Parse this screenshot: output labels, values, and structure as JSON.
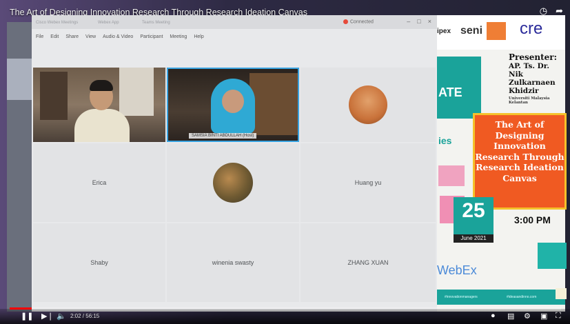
{
  "video": {
    "title": "The Art of Designing Innovation Research Through Research Ideation Canvas",
    "time": "2:02 / 56:15",
    "progress": 0.04
  },
  "webex": {
    "tabs": [
      "Cisco Webex Meetings",
      "Webex App",
      "Teams Meeting"
    ],
    "connection": "Connected",
    "menu": [
      "File",
      "Edit",
      "Share",
      "View",
      "Audio & Video",
      "Participant",
      "Meeting",
      "Help"
    ],
    "participants": [
      {
        "name": "",
        "type": "video"
      },
      {
        "name": "SAMSIA BINTI ABDULLAH (Host)",
        "type": "video"
      },
      {
        "name": "",
        "type": "avatar"
      },
      {
        "name": "Erica",
        "type": "name"
      },
      {
        "name": "",
        "type": "avatar"
      },
      {
        "name": "Huang yu",
        "type": "name"
      },
      {
        "name": "Shaby",
        "type": "name"
      },
      {
        "name": "winenia swasty",
        "type": "name"
      },
      {
        "name": "ZHANG XUAN",
        "type": "name"
      }
    ]
  },
  "slide": {
    "logo1": "ipex",
    "logo2": "seni",
    "logo3": "cre",
    "partial_word": "ATE",
    "partial_word2": "ies",
    "presenter_label": "Presenter:",
    "presenter_name": "AP. Ts. Dr. Nik Zulkarnaen Khidzir",
    "presenter_affiliation": "Universiti Malaysia Kelantan",
    "title": "The Art of Designing Innovation Research Through Research Ideation Canvas",
    "date_day": "25",
    "date_month": "June 2021",
    "time": "3:00 PM",
    "brand": "WebEx",
    "footer_left": "#innovationmanagers",
    "footer_right": "#ideasandinno.com"
  },
  "colors": {
    "accent_orange": "#f05a22",
    "accent_teal": "#1aa39a",
    "active_speaker": "#39a3e0"
  }
}
